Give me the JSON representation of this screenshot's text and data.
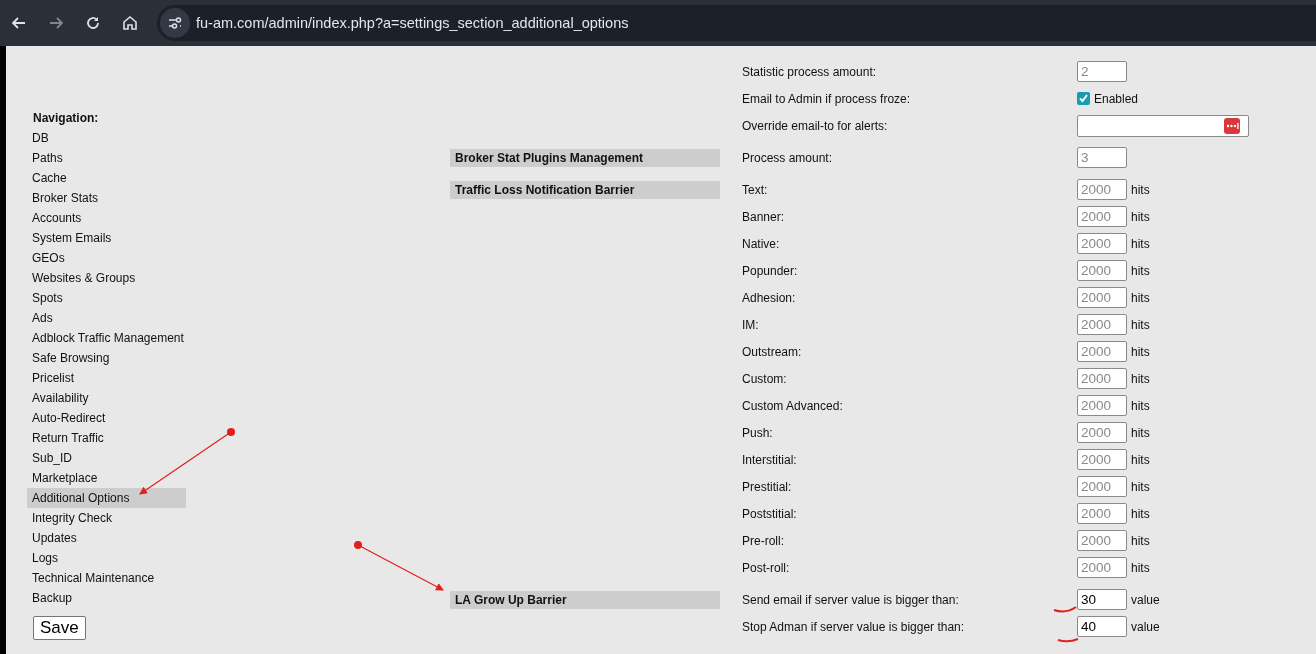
{
  "browser": {
    "url": "fu-am.com/admin/index.php?a=settings_section_additional_options"
  },
  "navigation": {
    "title": "Navigation:",
    "items": [
      {
        "label": "DB",
        "selected": false
      },
      {
        "label": "Paths",
        "selected": false
      },
      {
        "label": "Cache",
        "selected": false
      },
      {
        "label": "Broker Stats",
        "selected": false
      },
      {
        "label": "Accounts",
        "selected": false
      },
      {
        "label": "System Emails",
        "selected": false
      },
      {
        "label": "GEOs",
        "selected": false
      },
      {
        "label": "Websites & Groups",
        "selected": false
      },
      {
        "label": "Spots",
        "selected": false
      },
      {
        "label": "Ads",
        "selected": false
      },
      {
        "label": "Adblock Traffic Management",
        "selected": false
      },
      {
        "label": "Safe Browsing",
        "selected": false
      },
      {
        "label": "Pricelist",
        "selected": false
      },
      {
        "label": "Availability",
        "selected": false
      },
      {
        "label": "Auto-Redirect",
        "selected": false
      },
      {
        "label": "Return Traffic",
        "selected": false
      },
      {
        "label": "Sub_ID",
        "selected": false
      },
      {
        "label": "Marketplace",
        "selected": false
      },
      {
        "label": "Additional Options",
        "selected": true
      },
      {
        "label": "Integrity Check",
        "selected": false
      },
      {
        "label": "Updates",
        "selected": false
      },
      {
        "label": "Logs",
        "selected": false
      },
      {
        "label": "Technical Maintenance",
        "selected": false
      },
      {
        "label": "Backup",
        "selected": false
      }
    ]
  },
  "save_button": "Save",
  "sections": [
    {
      "rows": [
        {
          "kind": "number",
          "label": "Statistic process amount:",
          "placeholder": "2"
        },
        {
          "kind": "checkbox",
          "label": "Email to Admin if process froze:",
          "checked": true,
          "text": "Enabled"
        },
        {
          "kind": "email",
          "label": "Override email-to for alerts:"
        }
      ]
    },
    {
      "title": "Broker Stat Plugins Management",
      "rows": [
        {
          "kind": "number",
          "label": "Process amount:",
          "placeholder": "3"
        }
      ]
    },
    {
      "title": "Traffic Loss Notification Barrier",
      "rows": [
        {
          "kind": "number",
          "label": "Text:",
          "placeholder": "2000",
          "unit": "hits"
        },
        {
          "kind": "number",
          "label": "Banner:",
          "placeholder": "2000",
          "unit": "hits"
        },
        {
          "kind": "number",
          "label": "Native:",
          "placeholder": "2000",
          "unit": "hits"
        },
        {
          "kind": "number",
          "label": "Popunder:",
          "placeholder": "2000",
          "unit": "hits"
        },
        {
          "kind": "number",
          "label": "Adhesion:",
          "placeholder": "2000",
          "unit": "hits"
        },
        {
          "kind": "number",
          "label": "IM:",
          "placeholder": "2000",
          "unit": "hits"
        },
        {
          "kind": "number",
          "label": "Outstream:",
          "placeholder": "2000",
          "unit": "hits"
        },
        {
          "kind": "number",
          "label": "Custom:",
          "placeholder": "2000",
          "unit": "hits"
        },
        {
          "kind": "number",
          "label": "Custom Advanced:",
          "placeholder": "2000",
          "unit": "hits"
        },
        {
          "kind": "number",
          "label": "Push:",
          "placeholder": "2000",
          "unit": "hits"
        },
        {
          "kind": "number",
          "label": "Interstitial:",
          "placeholder": "2000",
          "unit": "hits"
        },
        {
          "kind": "number",
          "label": "Prestitial:",
          "placeholder": "2000",
          "unit": "hits"
        },
        {
          "kind": "number",
          "label": "Poststitial:",
          "placeholder": "2000",
          "unit": "hits"
        },
        {
          "kind": "number",
          "label": "Pre-roll:",
          "placeholder": "2000",
          "unit": "hits"
        },
        {
          "kind": "number",
          "label": "Post-roll:",
          "placeholder": "2000",
          "unit": "hits"
        }
      ]
    },
    {
      "title": "LA Grow Up Barrier",
      "rows": [
        {
          "kind": "number",
          "label": "Send email if server value is bigger than:",
          "value": "30",
          "unit": "value"
        },
        {
          "kind": "number",
          "label": "Stop Adman if server value is bigger than:",
          "value": "40",
          "unit": "value"
        }
      ]
    }
  ]
}
